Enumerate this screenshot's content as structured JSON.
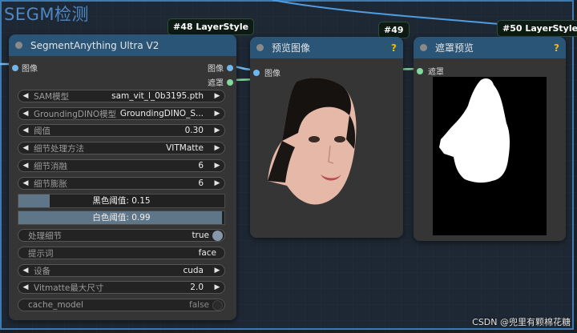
{
  "group": {
    "title": "SEGM检测"
  },
  "badges": {
    "b48": "#48 LayerStyle",
    "b49": "#49",
    "b50": "#50 LayerStyle"
  },
  "segment_node": {
    "title": "SegmentAnything Ultra V2",
    "input_image": "图像",
    "output_image": "图像",
    "output_mask": "遮罩",
    "widgets": [
      {
        "label": "SAM模型",
        "value": "sam_vit_l_0b3195.pth"
      },
      {
        "label": "GroundingDINO模型",
        "value": "GroundingDINO_S..."
      },
      {
        "label": "阈值",
        "value": "0.30"
      },
      {
        "label": "细节处理方法",
        "value": "VITMatte"
      },
      {
        "label": "细节消融",
        "value": "6"
      },
      {
        "label": "细节膨胀",
        "value": "6"
      }
    ],
    "sliders": [
      {
        "label": "黑色阈值: 0.15",
        "value": 0.15
      },
      {
        "label": "白色阈值: 0.99",
        "value": 0.99
      }
    ],
    "detail_toggle": {
      "label": "处理细节",
      "value": "true"
    },
    "prompt": {
      "label": "提示词",
      "value": "face"
    },
    "device": {
      "label": "设备",
      "value": "cuda"
    },
    "vitmatte": {
      "label": "Vitmatte最大尺寸",
      "value": "2.0"
    },
    "cache_toggle": {
      "label": "cache_model",
      "value": "false"
    }
  },
  "preview_node": {
    "title": "预览图像",
    "input_image": "图像",
    "help": "?"
  },
  "mask_node": {
    "title": "遮罩预览",
    "input_mask": "遮罩",
    "help": "?"
  },
  "watermark": "CSDN @兜里有颗棉花糖",
  "colors": {
    "accent_blue": "#6fb7ee",
    "accent_green": "#83d89b",
    "header": "#2a5577",
    "group": "#3f7ab0"
  }
}
